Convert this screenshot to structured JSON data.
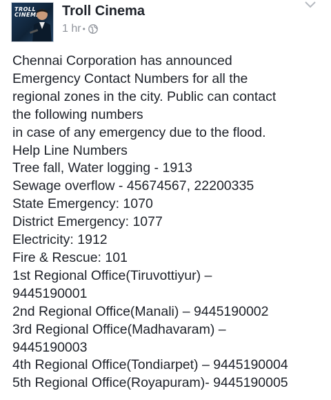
{
  "post": {
    "page_name": "Troll Cinema",
    "time": "1 hr",
    "separator": "•",
    "privacy_icon": "globe-icon",
    "menu_icon": "chevron-down-icon",
    "avatar_logo_text": "TROLL CINEMA",
    "lines": [
      "Chennai Corporation has announced",
      "Emergency Contact Numbers for all the",
      "regional zones in the city. Public can contact",
      "the following numbers",
      "in case of any emergency due to the flood.",
      "Help Line Numbers",
      "Tree fall, Water logging - 1913",
      "Sewage overflow - 45674567, 22200335",
      "State Emergency: 1070",
      "District Emergency: 1077",
      "Electricity: 1912",
      "Fire & Rescue: 101",
      "1st Regional Office(Tiruvottiyur) –",
      "9445190001",
      "2nd Regional Office(Manali) – 9445190002",
      "3rd Regional Office(Madhavaram) –",
      "9445190003",
      "4th Regional Office(Tondiarpet) – 9445190004",
      "5th Regional Office(Royapuram)- 9445190005"
    ]
  },
  "colors": {
    "text": "#1d2129",
    "meta": "#90949c",
    "background": "#ffffff"
  }
}
